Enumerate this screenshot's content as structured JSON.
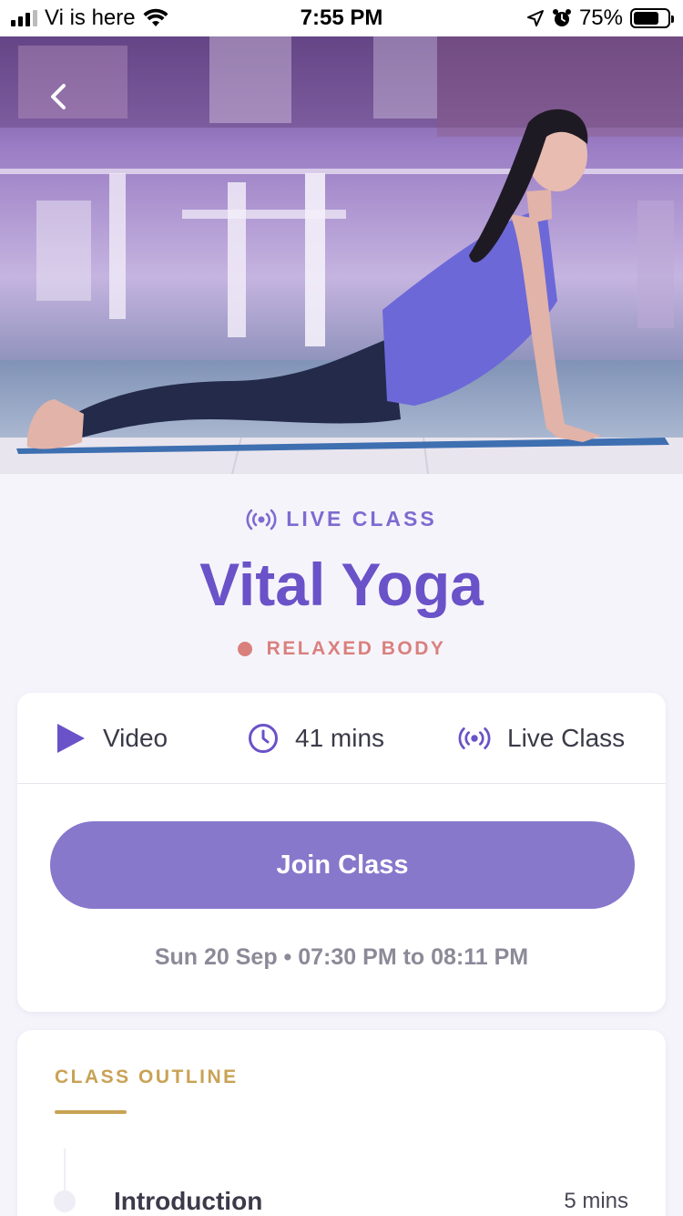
{
  "status_bar": {
    "carrier": "Vi is here",
    "time": "7:55 PM",
    "battery_percent": "75%",
    "battery_level": 0.75
  },
  "hero": {
    "image_subject": "woman-yoga-cobra-pose-photo"
  },
  "header": {
    "live_label": "LIVE CLASS",
    "title": "Vital Yoga",
    "category": "RELAXED BODY"
  },
  "info": {
    "format": "Video",
    "duration": "41 mins",
    "type": "Live Class",
    "join_label": "Join Class",
    "schedule": "Sun 20 Sep • 07:30 PM to 08:11 PM"
  },
  "outline": {
    "title": "CLASS OUTLINE",
    "items": [
      {
        "title": "Introduction",
        "duration": "5 mins"
      }
    ]
  },
  "colors": {
    "brand_purple": "#6a52c8",
    "accent_purple": "#8778cc",
    "category_red": "#d9807d",
    "outline_gold": "#c9a255",
    "background": "#f6f4fb"
  }
}
